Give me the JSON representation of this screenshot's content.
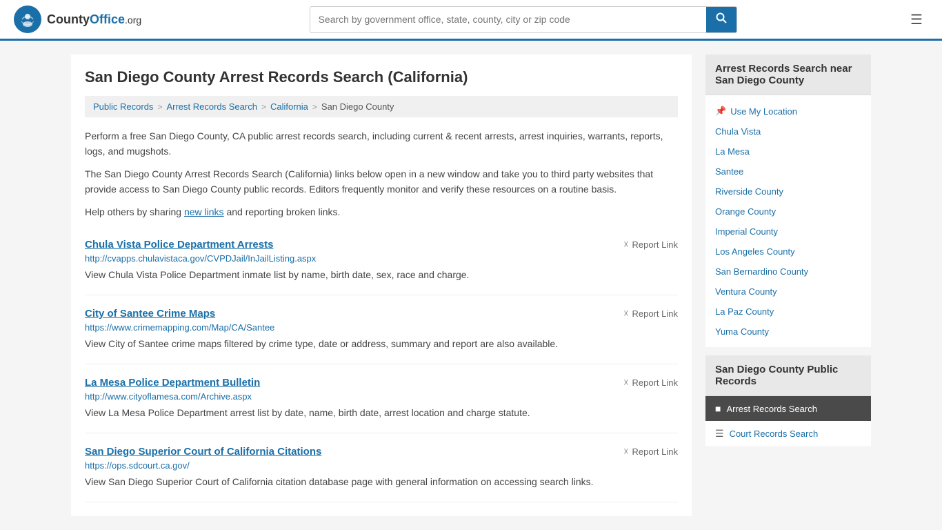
{
  "header": {
    "logo_text": "CountyOffice",
    "logo_suffix": ".org",
    "search_placeholder": "Search by government office, state, county, city or zip code",
    "search_value": ""
  },
  "page": {
    "title": "San Diego County Arrest Records Search (California)"
  },
  "breadcrumb": {
    "items": [
      "Public Records",
      "Arrest Records Search",
      "California",
      "San Diego County"
    ]
  },
  "intro": {
    "para1": "Perform a free San Diego County, CA public arrest records search, including current & recent arrests, arrest inquiries, warrants, reports, logs, and mugshots.",
    "para2": "The San Diego County Arrest Records Search (California) links below open in a new window and take you to third party websites that provide access to San Diego County public records. Editors frequently monitor and verify these resources on a routine basis.",
    "para3_before": "Help others by sharing ",
    "para3_link": "new links",
    "para3_after": " and reporting broken links."
  },
  "results": [
    {
      "title": "Chula Vista Police Department Arrests",
      "url": "http://cvapps.chulavistaca.gov/CVPDJail/InJailListing.aspx",
      "desc": "View Chula Vista Police Department inmate list by name, birth date, sex, race and charge.",
      "report_label": "Report Link"
    },
    {
      "title": "City of Santee Crime Maps",
      "url": "https://www.crimemapping.com/Map/CA/Santee",
      "desc": "View City of Santee crime maps filtered by crime type, date or address, summary and report are also available.",
      "report_label": "Report Link"
    },
    {
      "title": "La Mesa Police Department Bulletin",
      "url": "http://www.cityoflamesa.com/Archive.aspx",
      "desc": "View La Mesa Police Department arrest list by date, name, birth date, arrest location and charge statute.",
      "report_label": "Report Link"
    },
    {
      "title": "San Diego Superior Court of California Citations",
      "url": "https://ops.sdcourt.ca.gov/",
      "desc": "View San Diego Superior Court of California citation database page with general information on accessing search links.",
      "report_label": "Report Link"
    }
  ],
  "sidebar": {
    "nearby_title": "Arrest Records Search near San Diego County",
    "use_my_location": "Use My Location",
    "nearby_items": [
      "Chula Vista",
      "La Mesa",
      "Santee",
      "Riverside County",
      "Orange County",
      "Imperial County",
      "Los Angeles County",
      "San Bernardino County",
      "Ventura County",
      "La Paz County",
      "Yuma County"
    ],
    "public_records_title": "San Diego County Public Records",
    "public_records_active": "Arrest Records Search",
    "public_records_inactive": "Court Records Search"
  }
}
